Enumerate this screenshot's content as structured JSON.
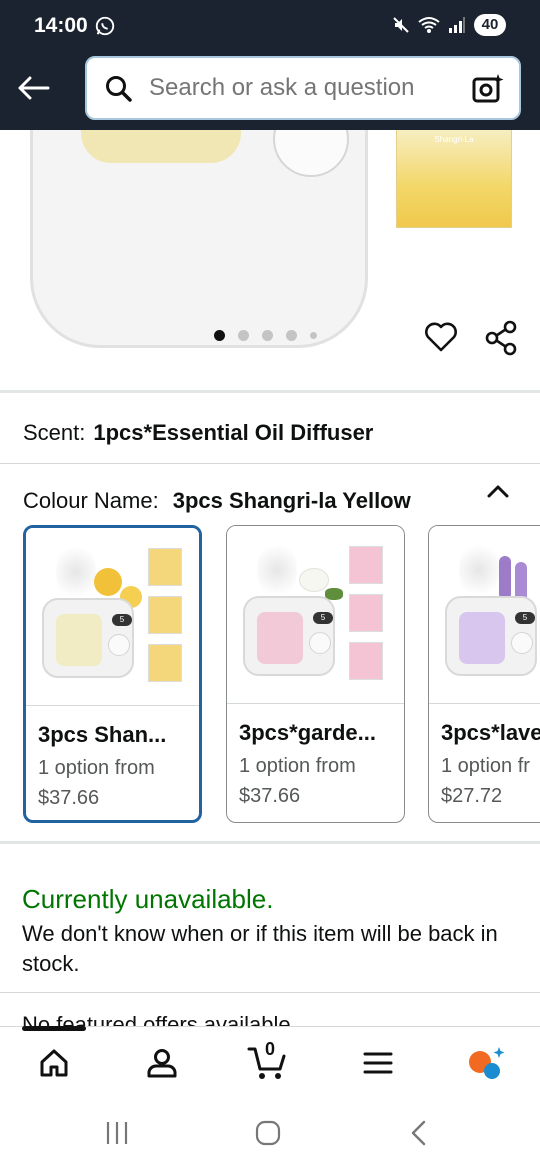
{
  "status_bar": {
    "time": "14:00",
    "battery": "40"
  },
  "search": {
    "placeholder": "Search or ask a question"
  },
  "product_image": {
    "sachet_label": "Shangri-La",
    "dots_total": 5,
    "dots_active": 1
  },
  "scent": {
    "label": "Scent:",
    "value": "1pcs*Essential Oil Diffuser"
  },
  "colour": {
    "label": "Colour Name:",
    "value": "3pcs Shangri-la Yellow"
  },
  "swatches": [
    {
      "title": "3pcs Shan...",
      "sub": "1 option from",
      "price": "$37.66",
      "selected": true,
      "pod_color": "#f1ecc4",
      "sachet_color": "#f3d77a"
    },
    {
      "title": "3pcs*garde...",
      "sub": "1 option from",
      "price": "$37.66",
      "selected": false,
      "pod_color": "#f2c9d6",
      "sachet_color": "#f4c4d4"
    },
    {
      "title": "3pcs*lave",
      "sub": "1 option fr",
      "price": "$27.72",
      "selected": false,
      "pod_color": "#d9c6ee",
      "sachet_color": "#d6c4ee"
    }
  ],
  "availability": {
    "title": "Currently unavailable.",
    "text": "We don't know when or if this item will be back in stock."
  },
  "offers": {
    "text": "No featured offers available"
  },
  "bottom_nav": {
    "cart_count": "0"
  },
  "colors": {
    "header_bg": "#1b2330",
    "accent_blue": "#2162a1",
    "available_green": "#007600",
    "alexa_orange": "#f26a21",
    "alexa_blue": "#1a8ccf"
  }
}
